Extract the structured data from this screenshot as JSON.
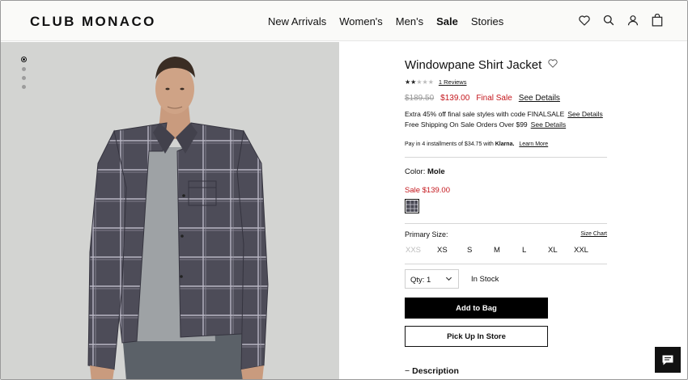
{
  "brand": {
    "logo_text": "CLUB MONACO"
  },
  "nav": {
    "items": [
      {
        "label": "New Arrivals"
      },
      {
        "label": "Women's"
      },
      {
        "label": "Men's"
      },
      {
        "label": "Sale"
      },
      {
        "label": "Stories"
      }
    ]
  },
  "header_icons": [
    "heart-icon",
    "search-icon",
    "account-icon",
    "bag-icon"
  ],
  "gallery": {
    "image_count": 4,
    "active_index": 0
  },
  "product": {
    "title": "Windowpane Shirt Jacket",
    "rating": 2,
    "rating_max": 5,
    "reviews_label": "1 Reviews",
    "original_price": "$189.50",
    "sale_price": "$139.00",
    "final_sale_label": "Final Sale",
    "see_details": "See Details",
    "promo_line_1": "Extra 45% off final sale styles with code FINALSALE",
    "promo_line_2": "Free Shipping On Sale Orders Over $99",
    "klarna_prefix": "Pay in 4 installments of $34.75 with",
    "klarna_brand": "Klarna.",
    "learn_more": "Learn More",
    "color_label": "Color:",
    "color_value": "Mole",
    "swatch_sale_price": "Sale $139.00",
    "size_label": "Primary Size:",
    "size_chart": "Size Chart",
    "sizes": [
      {
        "label": "XXS",
        "available": false
      },
      {
        "label": "XS",
        "available": true
      },
      {
        "label": "S",
        "available": true
      },
      {
        "label": "M",
        "available": true
      },
      {
        "label": "L",
        "available": true
      },
      {
        "label": "XL",
        "available": true
      },
      {
        "label": "XXL",
        "available": true
      }
    ],
    "qty_label": "Qty: 1",
    "stock_status": "In Stock",
    "add_to_bag": "Add to Bag",
    "pick_up": "Pick Up In Store",
    "description_label": "Description"
  },
  "colors": {
    "sale_red": "#c4161c",
    "button_black": "#000000",
    "image_bg": "#d3d4d2",
    "jacket": "#4a4a55"
  }
}
